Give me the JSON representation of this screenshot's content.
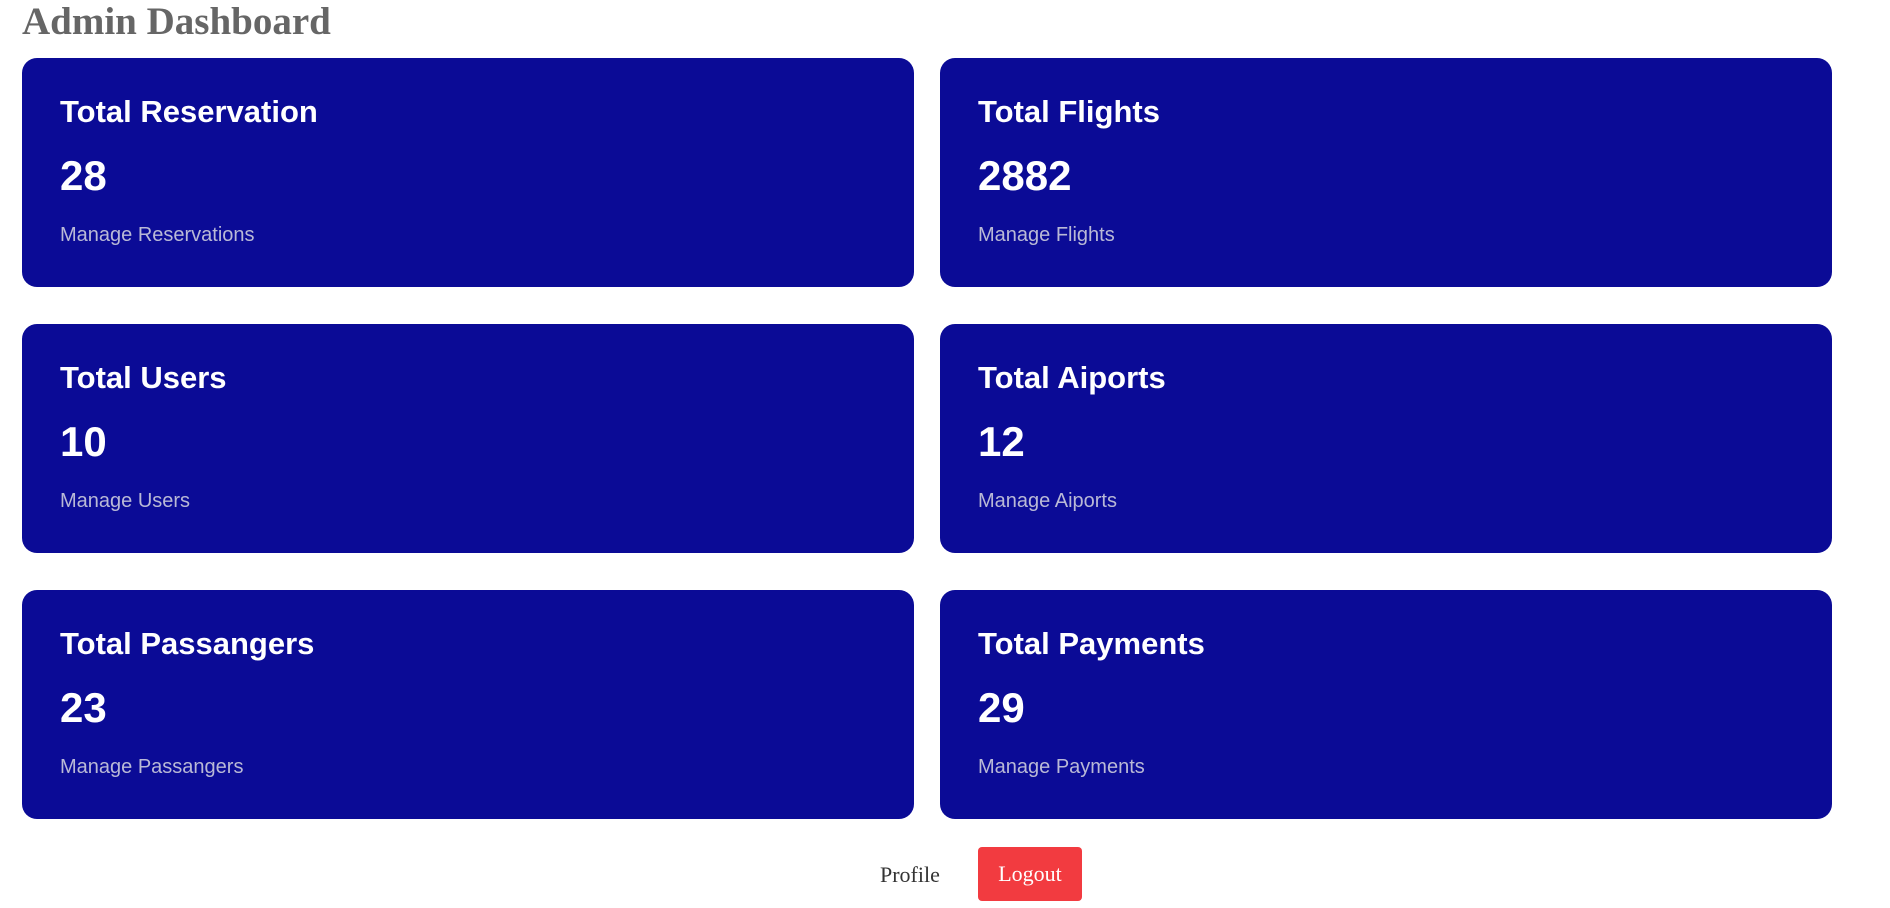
{
  "page": {
    "title": "Admin Dashboard"
  },
  "colors": {
    "card_background": "#0b0b96",
    "card_text": "#ffffff",
    "card_link_text": "#b9b9d6",
    "title_text": "#666666",
    "logout_background": "#f23b40"
  },
  "cards": [
    {
      "title": "Total Reservation",
      "count": "28",
      "link": "Manage Reservations"
    },
    {
      "title": "Total Flights",
      "count": "2882",
      "link": "Manage Flights"
    },
    {
      "title": "Total Users",
      "count": "10",
      "link": "Manage Users"
    },
    {
      "title": "Total Aiports",
      "count": "12",
      "link": "Manage Aiports"
    },
    {
      "title": "Total Passangers",
      "count": "23",
      "link": "Manage Passangers"
    },
    {
      "title": "Total Payments",
      "count": "29",
      "link": "Manage Payments"
    }
  ],
  "footer": {
    "profile_label": "Profile",
    "logout_label": "Logout"
  }
}
